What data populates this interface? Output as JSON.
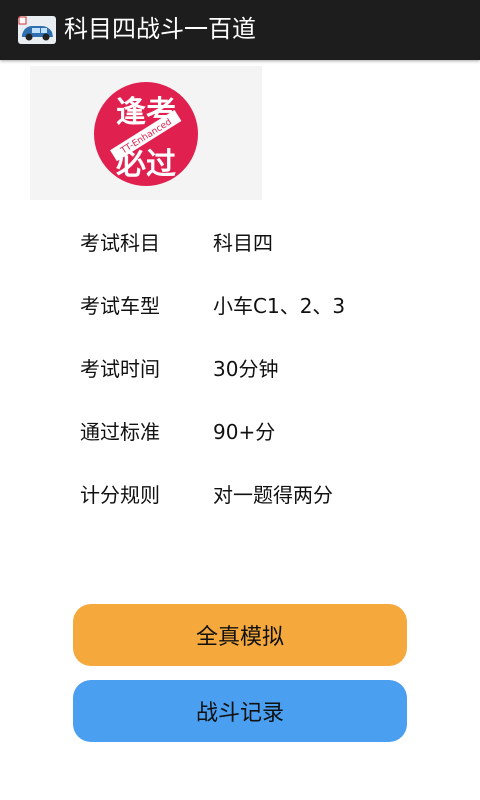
{
  "app_bar": {
    "title": "科目四战斗一百道",
    "icon": "car-icon"
  },
  "logo": {
    "line1": "逢考",
    "line2": "必过",
    "ribbon": "TT-Enhanced",
    "color": "#e0204e"
  },
  "info": [
    {
      "label": "考试科目",
      "value": "科目四"
    },
    {
      "label": "考试车型",
      "value": "小车C1、2、3"
    },
    {
      "label": "考试时间",
      "value": "30分钟"
    },
    {
      "label": "通过标准",
      "value": "90+分"
    },
    {
      "label": "计分规则",
      "value": "对一题得两分"
    }
  ],
  "buttons": {
    "exam_label": "全真模拟",
    "record_label": "战斗记录",
    "exam_color": "#f5a93c",
    "record_color": "#4a9ff0"
  }
}
